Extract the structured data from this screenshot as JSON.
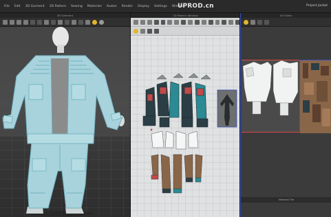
{
  "menubar": {
    "items": [
      "File",
      "Edit",
      "3D Garment",
      "2D Pattern",
      "Sewing",
      "Materials",
      "Avatar",
      "Render",
      "Display",
      "Settings",
      "Window"
    ],
    "watermark": "UPROD.cn",
    "project_name": "Project Jacket"
  },
  "panels": {
    "view3d": {
      "title": "3D Garment"
    },
    "view2d": {
      "title": "2D Pattern Window"
    },
    "uv": {
      "title": "UV Editor",
      "status": "Material Tile"
    }
  },
  "icons": {
    "toolbar3d": [
      "select-icon",
      "move-icon",
      "rotate-icon",
      "avatar-icon",
      "texture-icon",
      "wire-icon",
      "light-icon",
      "camera-icon",
      "pin-icon",
      "fold-icon",
      "measure-icon",
      "zoom-icon",
      "fit-icon",
      "render-icon",
      "color-icon"
    ],
    "toolbar2d": [
      "select-point-icon",
      "edit-curve-icon",
      "polygon-icon",
      "rectangle-icon",
      "circle-icon",
      "dart-icon",
      "internal-line-icon",
      "trace-icon",
      "seam-icon",
      "notch-icon",
      "fold-arrange-icon",
      "grade-icon",
      "symmetry-icon",
      "lock-icon",
      "ruler-icon",
      "pin-2d-icon",
      "layer-icon",
      "zoom-2d-icon"
    ],
    "toolbar_uv": [
      "uv-select-icon",
      "uv-move-icon",
      "uv-pin-icon",
      "uv-settings-icon"
    ]
  },
  "colors": {
    "garment_fabric": "#a8d3dc",
    "garment_seams": "#6fb1c0",
    "pattern_dark": "#2b3e45",
    "pattern_teal": "#2b8a93",
    "pattern_red": "#c24a4a",
    "pattern_brown": "#8a6648",
    "uv_border_active": "#e04848",
    "panel_border_selected": "#3e56b8",
    "accent_icon": "#e1b52c"
  }
}
